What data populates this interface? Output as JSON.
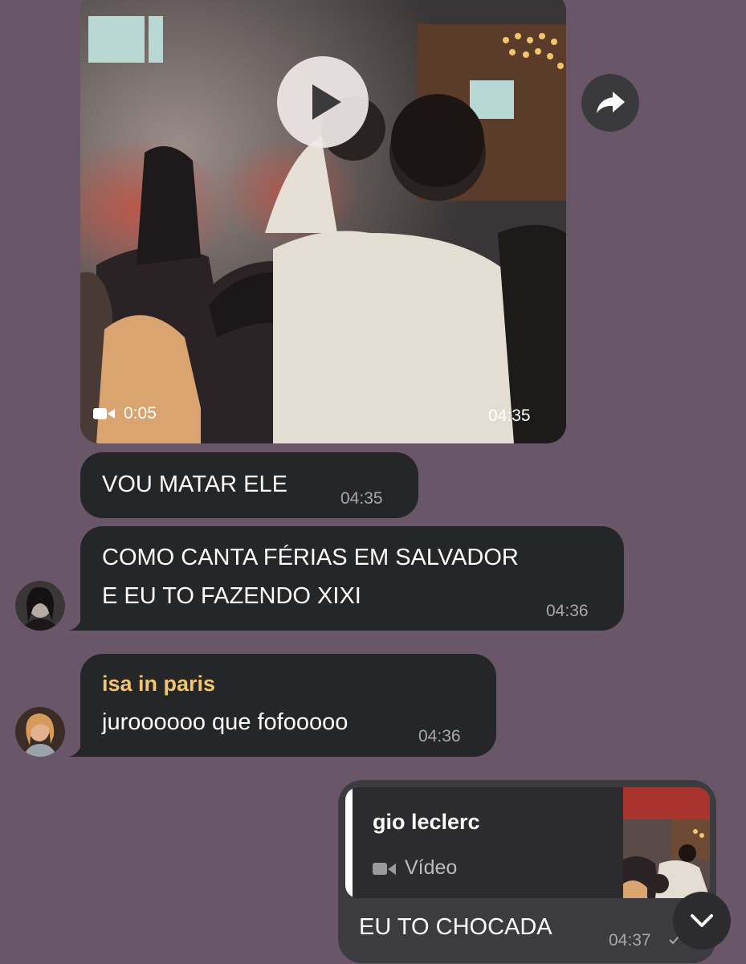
{
  "video": {
    "duration": "0:05",
    "time": "04:35"
  },
  "messages": [
    {
      "text": "VOU MATAR ELE",
      "time": "04:35"
    },
    {
      "text_lines": [
        "COMO CANTA FÉRIAS EM SALVADOR",
        "E EU TO FAZENDO XIXI"
      ],
      "time": "04:36"
    },
    {
      "sender": "isa in paris",
      "text": "juroooooo que fofooooo",
      "time": "04:36"
    }
  ],
  "reply": {
    "quoted_name": "gio leclerc",
    "quoted_type": "Vídeo",
    "text": "EU TO CHOCADA",
    "time": "04:37"
  },
  "colors": {
    "background": "#6a5669",
    "bubble_incoming": "#252627",
    "bubble_outgoing": "#3c3b40",
    "sender_name": "#f2c46f"
  },
  "icons": {
    "play": "play-icon",
    "forward": "forward-arrow-icon",
    "video_camera": "video-camera-icon",
    "scroll_down": "chevron-down-icon",
    "read_status": "checkmark-icon"
  }
}
